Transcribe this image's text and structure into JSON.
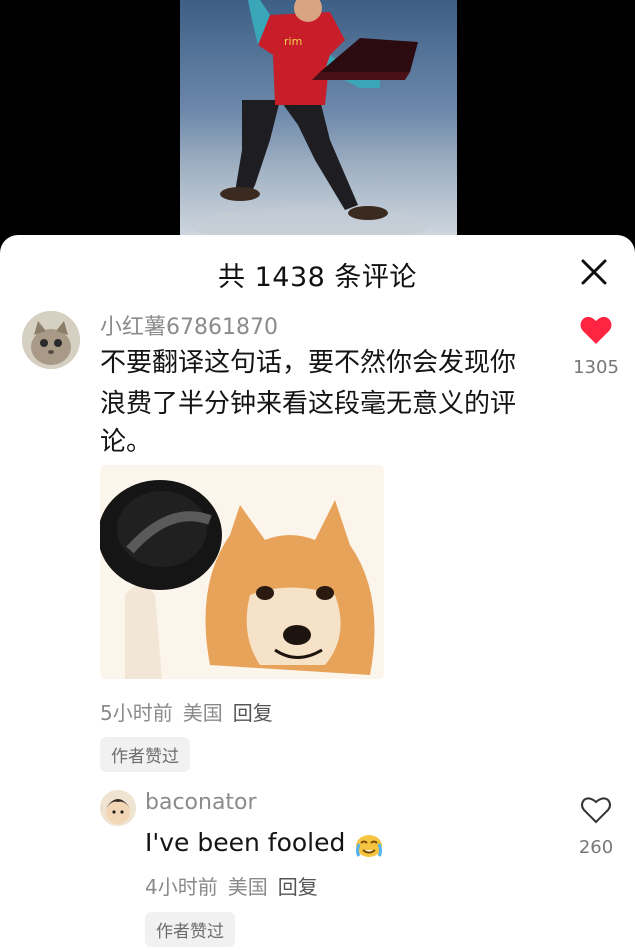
{
  "header": {
    "title": "共 1438 条评论",
    "close_icon": "close-icon"
  },
  "comments": [
    {
      "username": "小红薯67861870",
      "text_line1": "不要翻译这句话，要不然你会发现你",
      "text_line2": "浪费了半分钟来看这段毫无意义的评",
      "text_line3": "论。",
      "time": "5小时前",
      "location": "美国",
      "reply": "回复",
      "tag": "作者赞过",
      "likes": "1305",
      "liked": true,
      "like_color": "#ff2442"
    },
    {
      "username": "baconator",
      "text": "I've been fooled",
      "time": "4小时前",
      "location": "美国",
      "reply": "回复",
      "tag": "作者赞过",
      "likes": "260",
      "liked": false
    }
  ]
}
